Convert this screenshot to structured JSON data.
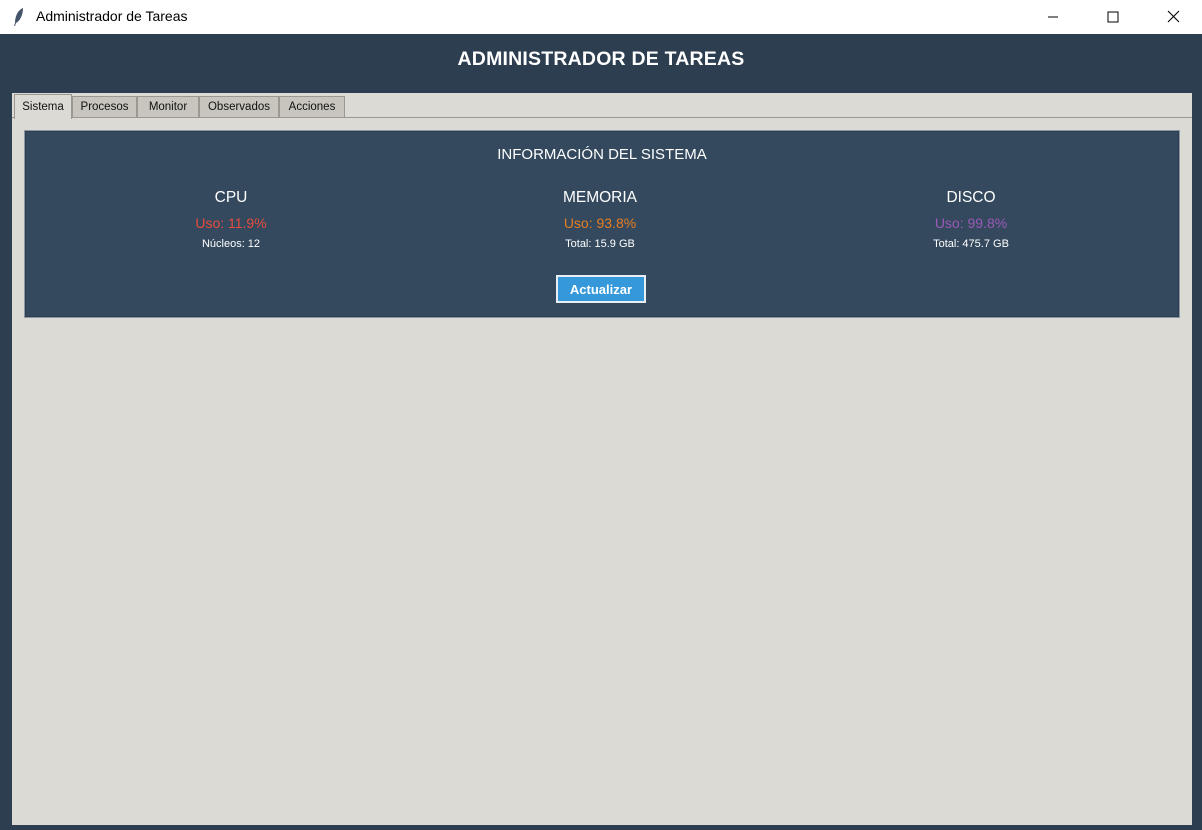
{
  "window": {
    "title": "Administrador de Tareas"
  },
  "header": {
    "title": "ADMINISTRADOR DE TAREAS"
  },
  "tabs": [
    {
      "label": "Sistema",
      "active": true
    },
    {
      "label": "Procesos",
      "active": false
    },
    {
      "label": "Monitor",
      "active": false
    },
    {
      "label": "Observados",
      "active": false
    },
    {
      "label": "Acciones",
      "active": false
    }
  ],
  "system_panel": {
    "title": "INFORMACIÓN DEL SISTEMA",
    "cpu": {
      "name": "CPU",
      "usage": "Uso: 11.9%",
      "detail": "Núcleos: 12",
      "color": "#e74c3c"
    },
    "memory": {
      "name": "MEMORIA",
      "usage": "Uso: 93.8%",
      "detail": "Total: 15.9 GB",
      "color": "#e67e22"
    },
    "disk": {
      "name": "DISCO",
      "usage": "Uso: 99.8%",
      "detail": "Total: 475.7 GB",
      "color": "#9b59b6"
    },
    "refresh_label": "Actualizar"
  },
  "colors": {
    "header_bg": "#2c3e50",
    "panel_bg": "#34495e",
    "button_bg": "#3498db"
  }
}
